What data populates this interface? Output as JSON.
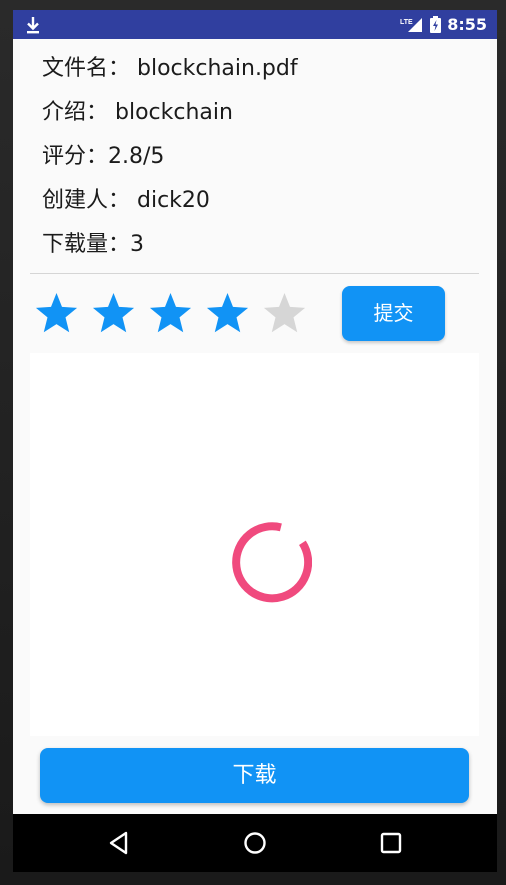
{
  "status_bar": {
    "time": "8:55",
    "network": "LTE",
    "icons": [
      "download-icon",
      "signal-icon",
      "battery-icon"
    ]
  },
  "file_info": {
    "rows": [
      "文件名： blockchain.pdf",
      "介绍： blockchain",
      "评分：2.8/5",
      "创建人： dick20",
      "下载量：3"
    ]
  },
  "rating": {
    "value": 4,
    "max": 5,
    "filled_color": "#1193f5",
    "empty_color": "#d6d6d6"
  },
  "submit_label": "提交",
  "preview": {
    "state": "loading",
    "spinner_color": "#f04a7e"
  },
  "download_label": "下载",
  "colors": {
    "status_bar": "#303f9f",
    "accent": "#1193f5",
    "background": "#fafafa"
  },
  "nav_bar": {
    "buttons": [
      "back-icon",
      "home-icon",
      "recents-icon"
    ]
  }
}
